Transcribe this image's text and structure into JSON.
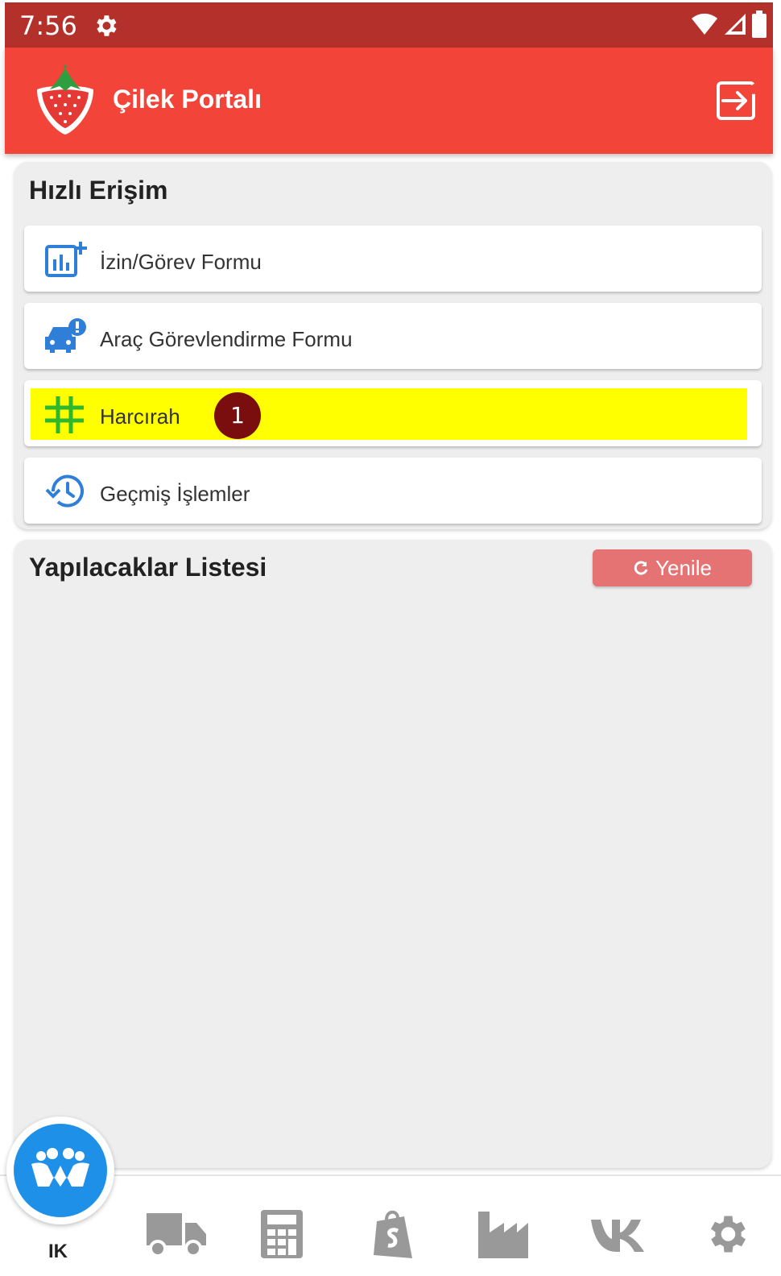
{
  "status_bar": {
    "time": "7:56"
  },
  "app_bar": {
    "title": "Çilek Portalı"
  },
  "quick_access": {
    "title": "Hızlı Erişim",
    "items": [
      {
        "label": "İzin/Görev Formu",
        "icon": "chart-add-icon"
      },
      {
        "label": "Araç Görevlendirme Formu",
        "icon": "car-alert-icon"
      },
      {
        "label": "Harcırah",
        "icon": "hashtag-icon",
        "badge": "1"
      },
      {
        "label": "Geçmiş İşlemler",
        "icon": "history-icon"
      }
    ]
  },
  "todo": {
    "title": "Yapılacaklar Listesi",
    "refresh_label": "Yenile"
  },
  "bottom_nav": {
    "active_label": "IK",
    "items": [
      "people-icon",
      "truck-icon",
      "calculator-icon",
      "shopify-bag-icon",
      "factory-icon",
      "vk-icon",
      "gear-icon"
    ]
  },
  "colors": {
    "status_bar": "#b3312a",
    "app_bar": "#f24438",
    "refresh": "#e57373",
    "fab": "#1e90e8",
    "highlight": "#ffff00",
    "icon_blue": "#2f7fd8",
    "icon_green": "#2db82d"
  }
}
